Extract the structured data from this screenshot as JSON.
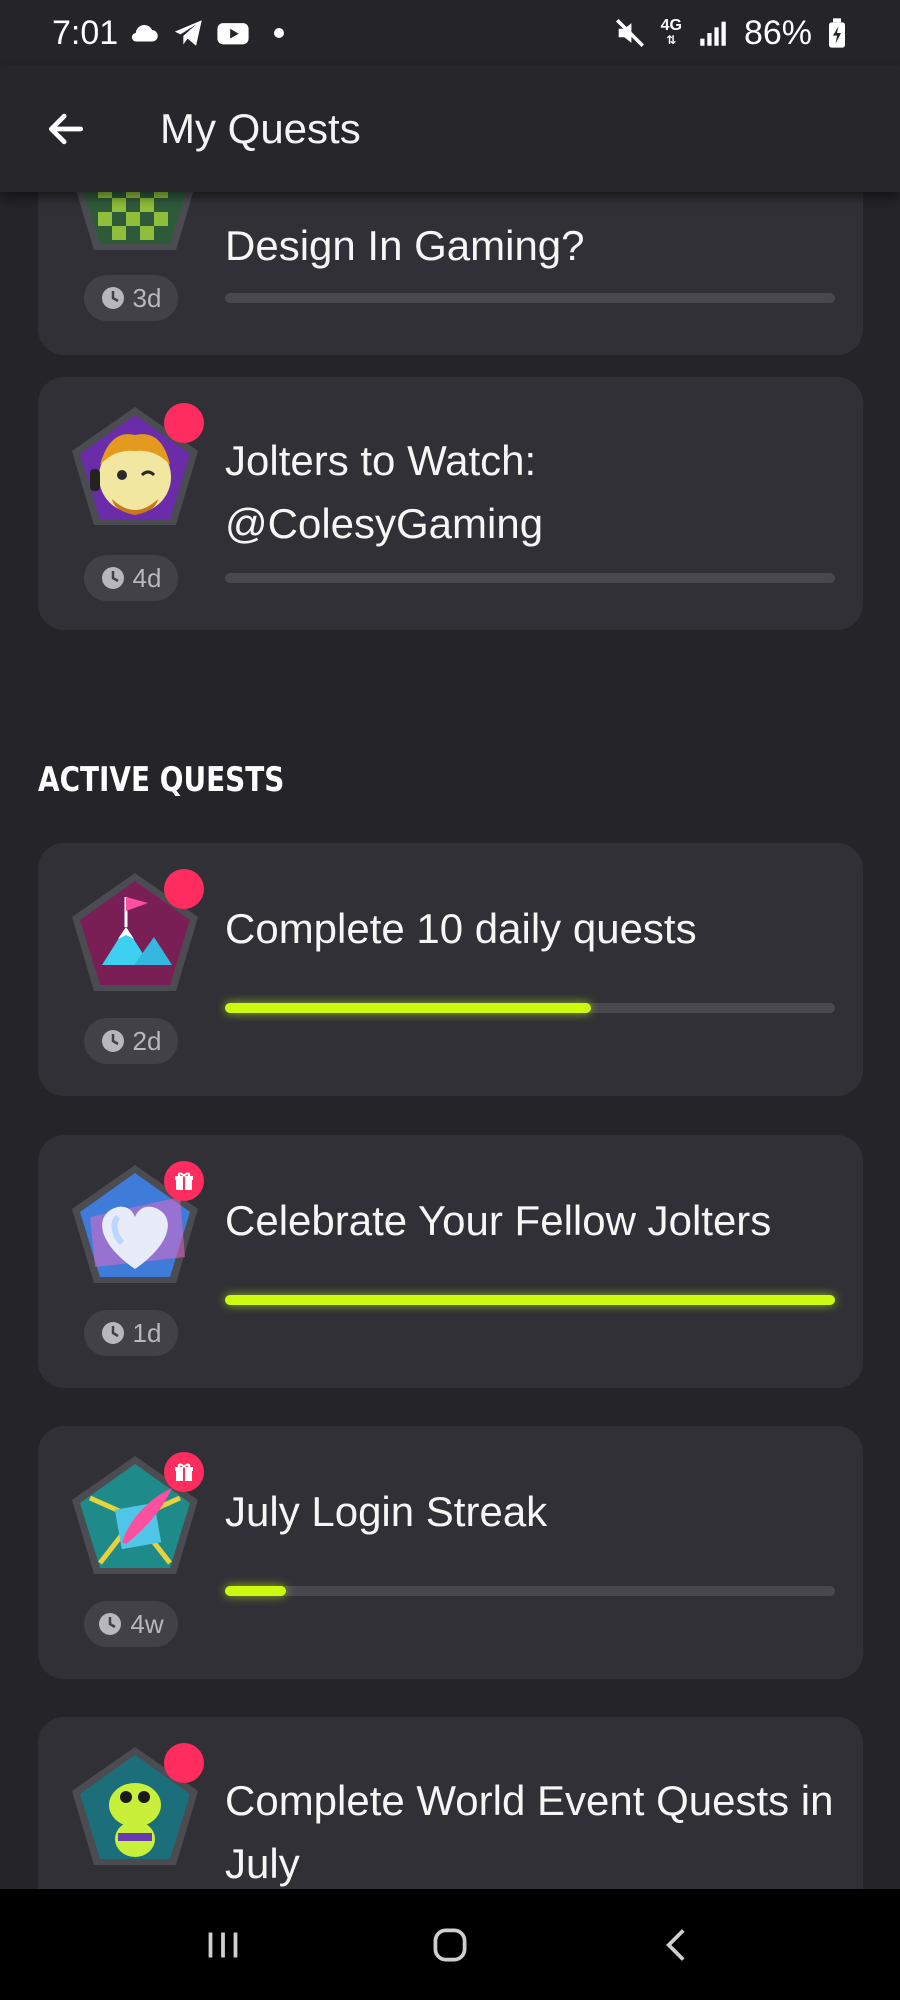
{
  "status_bar": {
    "time": "7:01",
    "network": "4G",
    "battery": "86%",
    "icons": [
      "cloud-icon",
      "telegram-icon",
      "youtube-icon",
      "notification-dot",
      "mute-icon",
      "signal-icon",
      "battery-icon"
    ]
  },
  "app_bar": {
    "title": "My Quests",
    "back_icon": "arrow-left-icon"
  },
  "quests_top": [
    {
      "title": "Design In Gaming?",
      "time_left": "3d",
      "progress": 0,
      "badge": "checkered-badge"
    },
    {
      "title": "Jolters to Watch: @ColesyGaming",
      "time_left": "4d",
      "progress": 0,
      "badge": "avatar-badge",
      "indicator": "dot"
    }
  ],
  "active_section": {
    "label": "ACTIVE QUESTS",
    "quests": [
      {
        "title": "Complete 10 daily quests",
        "time_left": "2d",
        "progress": 0.6,
        "badge": "mountain-flag-badge",
        "indicator": "dot"
      },
      {
        "title": "Celebrate Your Fellow Jolters",
        "time_left": "1d",
        "progress": 1.0,
        "badge": "heart-badge",
        "indicator": "gift"
      },
      {
        "title": "July Login Streak",
        "time_left": "4w",
        "progress": 0.1,
        "badge": "quill-badge",
        "indicator": "gift"
      },
      {
        "title": "Complete World Event Quests in July",
        "time_left": "",
        "progress": 0,
        "badge": "frog-badge",
        "indicator": "dot"
      }
    ]
  },
  "colors": {
    "background": "#242429",
    "card": "#303036",
    "progress": "#cdfb10",
    "notification": "#ff2d5f"
  },
  "nav_bar": {
    "icons": [
      "recents-icon",
      "home-icon",
      "back-icon"
    ]
  }
}
